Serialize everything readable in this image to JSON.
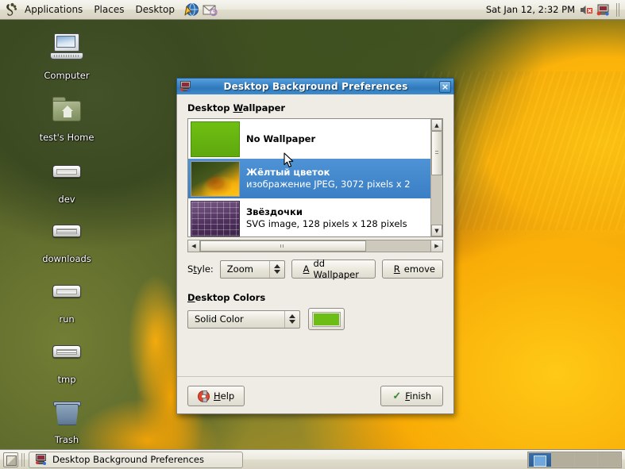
{
  "top_panel": {
    "foot_icon": "gnome-foot-icon",
    "menus": [
      {
        "label": "Applications",
        "name": "menu-applications"
      },
      {
        "label": "Places",
        "name": "menu-places"
      },
      {
        "label": "Desktop",
        "name": "menu-desktop"
      }
    ],
    "launchers": [
      {
        "name": "web-browser-launcher-icon"
      },
      {
        "name": "email-client-launcher-icon"
      }
    ],
    "clock": "Sat Jan 12,  2:32 PM",
    "tray": [
      {
        "name": "volume-muted-icon"
      },
      {
        "name": "display-settings-icon"
      }
    ]
  },
  "desktop_icons": [
    {
      "label": "Computer",
      "icon": "computer-icon",
      "name": "desktop-icon-computer"
    },
    {
      "label": "test's Home",
      "icon": "home-folder-icon",
      "name": "desktop-icon-home"
    },
    {
      "label": "dev",
      "icon": "drive-icon",
      "name": "desktop-icon-dev"
    },
    {
      "label": "downloads",
      "icon": "drive-icon",
      "name": "desktop-icon-downloads"
    },
    {
      "label": "run",
      "icon": "drive-icon",
      "name": "desktop-icon-run"
    },
    {
      "label": "tmp",
      "icon": "drive-icon",
      "name": "desktop-icon-tmp"
    },
    {
      "label": "Trash",
      "icon": "trash-icon",
      "name": "desktop-icon-trash"
    }
  ],
  "dialog": {
    "title": "Desktop Background Preferences",
    "window_icon": "display-preferences-icon",
    "close_label": "×",
    "wallpaper_section": "Desktop Wallpaper",
    "wallpaper_list": [
      {
        "title": "No Wallpaper",
        "subtitle": "",
        "thumb": "solid-green-thumb",
        "selected": false
      },
      {
        "title": "Жёлтый цветок",
        "subtitle": "изображение JPEG, 3072 pixels x 2",
        "thumb": "yellow-flower-thumb",
        "selected": true
      },
      {
        "title": "Звёздочки",
        "subtitle": "SVG image, 128 pixels x 128 pixels",
        "thumb": "stars-thumb",
        "selected": false
      }
    ],
    "scroll": {
      "up_arrow": "▲",
      "down_arrow": "▼",
      "left_arrow": "◀",
      "right_arrow": "▶"
    },
    "style_label": "Style:",
    "style_label_pre": "S",
    "style_label_u": "t",
    "style_label_post": "yle:",
    "style_value": "Zoom",
    "add_wallpaper": {
      "pre": "",
      "u": "A",
      "post": "dd Wallpaper"
    },
    "remove": {
      "pre": "",
      "u": "R",
      "post": "emove"
    },
    "colors_section_pre": "",
    "colors_section_u": "D",
    "colors_section_post": "esktop Colors",
    "wallpaper_section_pre": "Desktop ",
    "wallpaper_section_u": "W",
    "wallpaper_section_post": "allpaper",
    "color_mode": "Solid Color",
    "color_hex": "#6cbe16",
    "help_button": {
      "pre": "",
      "u": "H",
      "post": "elp"
    },
    "finish_button": {
      "pre": "",
      "u": "F",
      "post": "inish"
    }
  },
  "bottom_panel": {
    "show_desktop_icon": "show-desktop-icon",
    "tasks": [
      {
        "label": "Desktop Background Preferences",
        "icon": "display-preferences-icon",
        "active": true
      }
    ],
    "workspaces": [
      {
        "name": "workspace-1",
        "active": true
      },
      {
        "name": "workspace-2",
        "active": false
      },
      {
        "name": "workspace-3",
        "active": false
      },
      {
        "name": "workspace-4",
        "active": false
      }
    ]
  }
}
